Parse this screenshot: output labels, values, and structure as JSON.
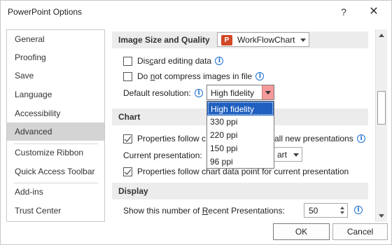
{
  "window": {
    "title": "PowerPoint Options",
    "help_glyph": "?",
    "close_glyph": "✕"
  },
  "sidebar": {
    "items": [
      {
        "label": "General"
      },
      {
        "label": "Proofing"
      },
      {
        "label": "Save"
      },
      {
        "label": "Language"
      },
      {
        "label": "Accessibility"
      },
      {
        "label": "Advanced",
        "active": true
      },
      {
        "label": "Customize Ribbon"
      },
      {
        "label": "Quick Access Toolbar"
      },
      {
        "label": "Add-ins"
      },
      {
        "label": "Trust Center"
      }
    ]
  },
  "image_section": {
    "title": "Image Size and Quality",
    "file_combo": {
      "value": "WorkFlowChart",
      "icon_text": "P"
    },
    "discard_editing": {
      "pre": "Dis",
      "u": "c",
      "post": "ard editing data",
      "checked": false
    },
    "no_compress": {
      "pre": "Do ",
      "u": "n",
      "post": "ot compress images in file",
      "checked": false
    },
    "default_resolution": {
      "label": "Default resolution:",
      "value": "High fidelity"
    }
  },
  "resolution_dropdown": {
    "options": [
      "High fidelity",
      "330 ppi",
      "220 ppi",
      "150 ppi",
      "96 ppi"
    ],
    "selected_index": 0
  },
  "chart_section": {
    "title": "Chart",
    "props_follow_new": {
      "pre": "Properties follow c",
      "post": "all new presentations",
      "checked": true
    },
    "current_presentation": {
      "label": "Current presentation:",
      "value_visible": "art"
    },
    "props_follow_current": {
      "label": "Properties follow chart data point for current presentation",
      "checked": true
    }
  },
  "display_section": {
    "title": "Display",
    "recent_presentations": {
      "pre": "Show this number of ",
      "u": "R",
      "post": "ecent Presentations:",
      "value": "50"
    }
  },
  "buttons": {
    "ok": "OK",
    "cancel": "Cancel"
  },
  "info_glyph": "i",
  "colors": {
    "accent_selection": "#1e5fbf",
    "active_sidebar": "#d4d4d4",
    "dropdown_arrow_bg": "#f59a9a",
    "ppt_icon": "#d24726"
  }
}
